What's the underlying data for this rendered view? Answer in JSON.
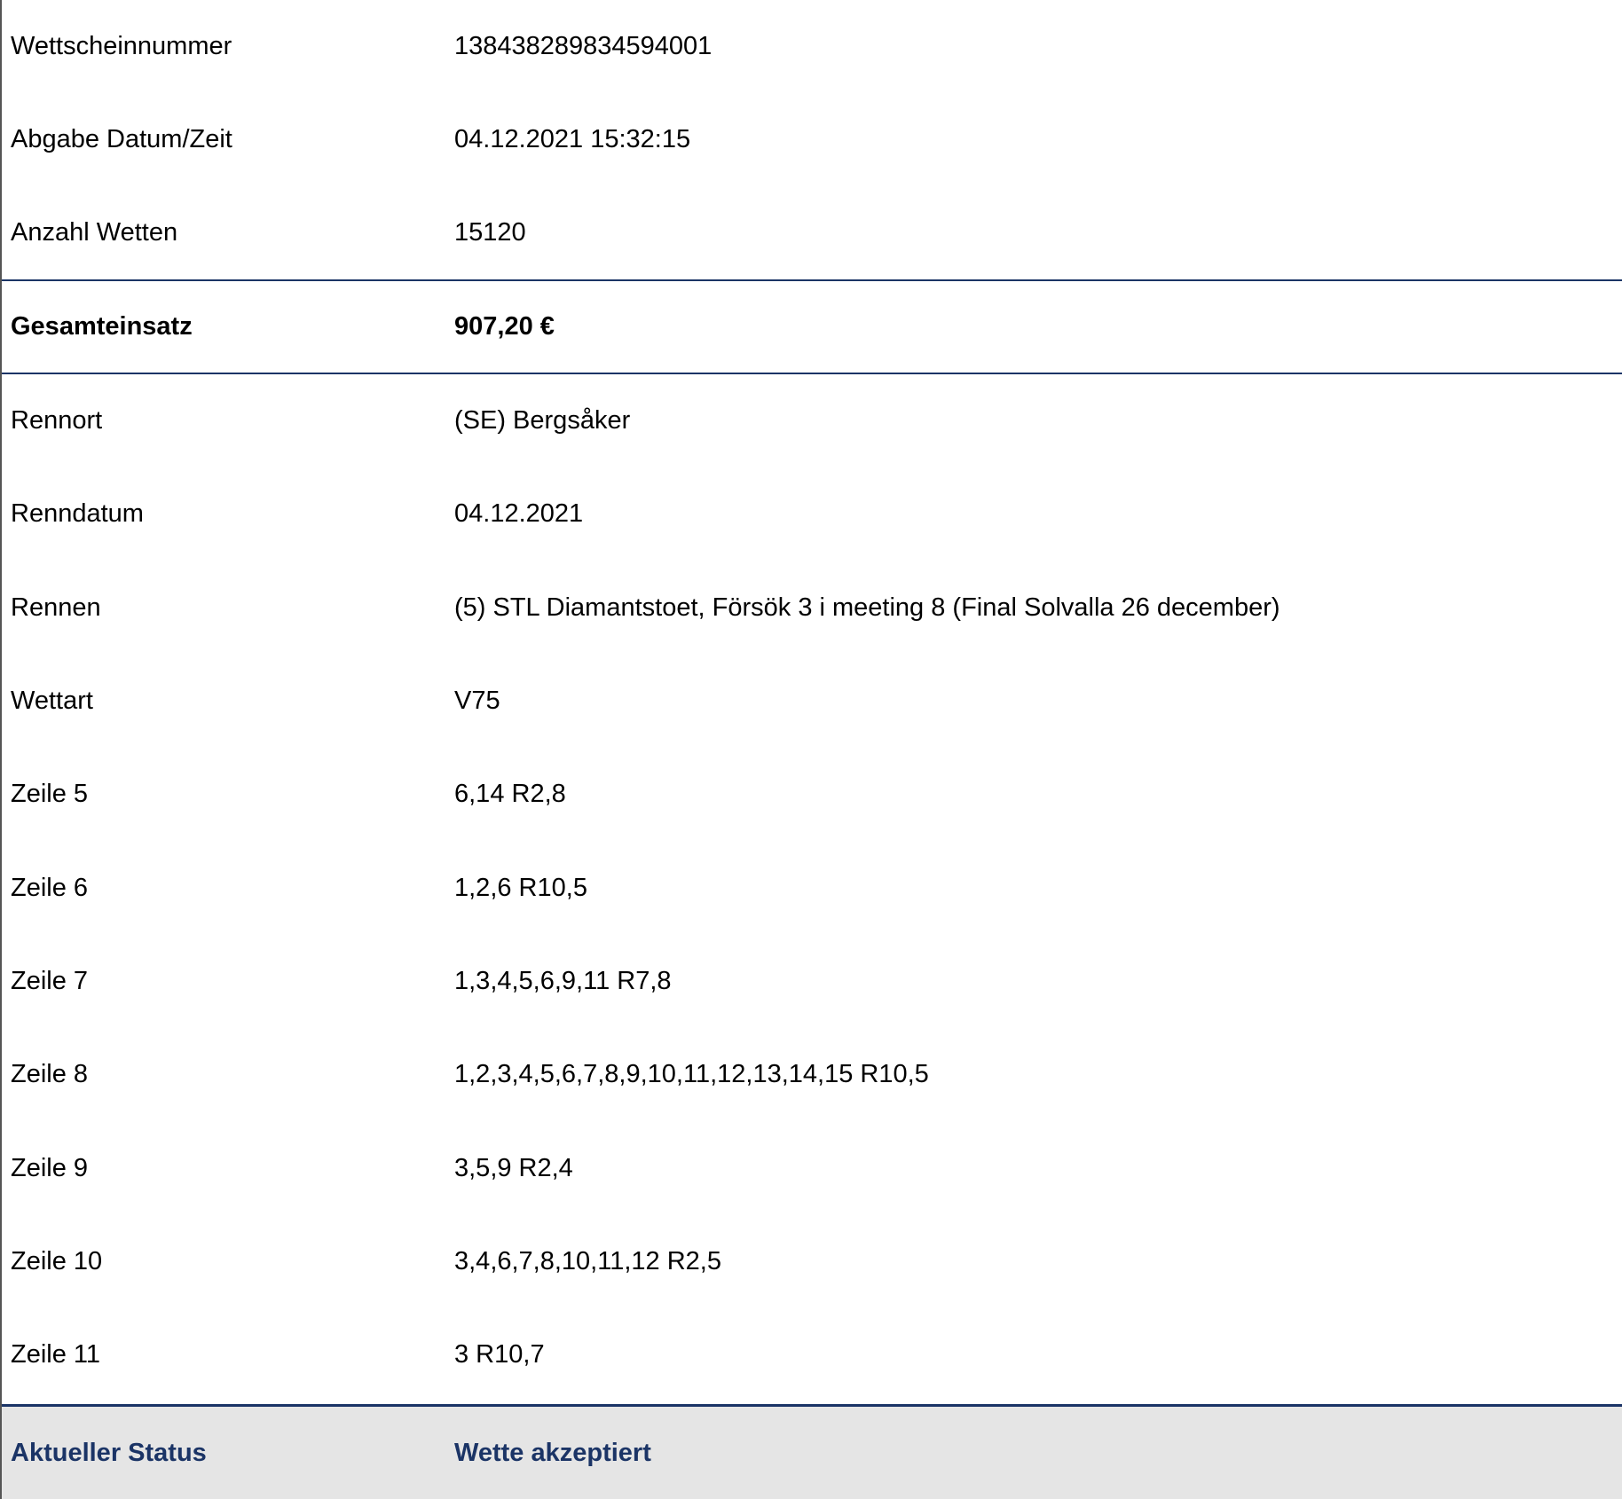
{
  "ticket": {
    "summary": [
      {
        "label": "Wettscheinnummer",
        "value": "13843828983459400​1"
      },
      {
        "label": "Abgabe Datum/Zeit",
        "value": "04.12.2021 15:32:15"
      },
      {
        "label": "Anzahl Wetten",
        "value": "15120"
      }
    ],
    "total": {
      "label": "Gesamteinsatz",
      "value": "907,20 €"
    },
    "details": [
      {
        "label": "Rennort",
        "value": "(SE) Bergsåker"
      },
      {
        "label": "Renndatum",
        "value": "04.12.2021"
      },
      {
        "label": "Rennen",
        "value": "(5) STL Diamantstoet, Försök 3 i meeting 8 (Final Solvalla 26 december)"
      },
      {
        "label": "Wettart",
        "value": "V75"
      },
      {
        "label": "Zeile 5",
        "value": "6,14 R2,8"
      },
      {
        "label": "Zeile 6",
        "value": "1,2,6 R10,5"
      },
      {
        "label": "Zeile 7",
        "value": "1,3,4,5,6,9,11 R7,8"
      },
      {
        "label": "Zeile 8",
        "value": "1,2,3,4,5,6,7,8,9,10,11,12,13,14,15 R10,5"
      },
      {
        "label": "Zeile 9",
        "value": "3,5,9 R2,4"
      },
      {
        "label": "Zeile 10",
        "value": "3,4,6,7,8,10,11,12 R2,5"
      },
      {
        "label": "Zeile 11",
        "value": "3 R10,7"
      }
    ],
    "status": {
      "label": "Aktueller Status",
      "value": "Wette akzeptiert"
    }
  },
  "colors": {
    "accent": "#1b3466",
    "status_background": "#e5e5e5"
  }
}
